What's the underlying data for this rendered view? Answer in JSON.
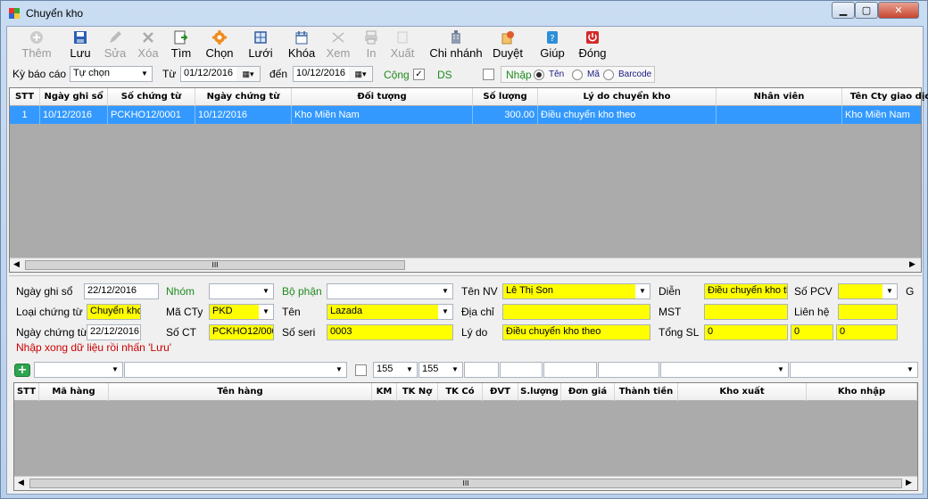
{
  "window": {
    "title": "Chuyển kho"
  },
  "toolbar": [
    {
      "label": "Thêm",
      "icon": "add-icon",
      "enabled": false
    },
    {
      "label": "Lưu",
      "icon": "save-icon",
      "enabled": true
    },
    {
      "label": "Sửa",
      "icon": "edit-icon",
      "enabled": false
    },
    {
      "label": "Xóa",
      "icon": "delete-icon",
      "enabled": false
    },
    {
      "label": "Tìm",
      "icon": "find-icon",
      "enabled": true
    },
    {
      "label": "Chọn",
      "icon": "gear-icon",
      "enabled": true
    },
    {
      "label": "Lưới",
      "icon": "grid-icon",
      "enabled": true
    },
    {
      "label": "Khóa",
      "icon": "lock-icon",
      "enabled": true
    },
    {
      "label": "Xem",
      "icon": "view-icon",
      "enabled": false
    },
    {
      "label": "In",
      "icon": "print-icon",
      "enabled": false
    },
    {
      "label": "Xuất",
      "icon": "export-icon",
      "enabled": false
    },
    {
      "label": "Chi nhánh",
      "icon": "branch-icon",
      "enabled": true
    },
    {
      "label": "Duyệt",
      "icon": "approve-icon",
      "enabled": true
    },
    {
      "label": "Giúp",
      "icon": "help-icon",
      "enabled": true
    },
    {
      "label": "Đóng",
      "icon": "power-icon",
      "enabled": true
    }
  ],
  "filter": {
    "period_label": "Kỳ báo cáo",
    "period_value": "Tự chọn",
    "from_label": "Từ",
    "from_value": "01/12/2016",
    "to_label": "đến",
    "to_value": "10/12/2016",
    "cong_label": "Cộng",
    "ds_label": "DS",
    "nhap_label": "Nhập",
    "radio_ten": "Tên",
    "radio_ma": "Mã",
    "radio_barcode": "Barcode"
  },
  "top_grid": {
    "headers": [
      "STT",
      "Ngày ghi sổ",
      "Số chứng từ",
      "Ngày chứng từ",
      "Đối tượng",
      "Số lượng",
      "Lý do chuyển kho",
      "Nhân viên",
      "Tên Cty giao dịch"
    ],
    "rows": [
      [
        "1",
        "10/12/2016",
        "PCKHO12/0001",
        "10/12/2016",
        "Kho Miền Nam",
        "300.00",
        "Điều chuyển kho theo",
        "",
        "Kho Miền Nam"
      ]
    ],
    "scroll_glyph": "III"
  },
  "form": {
    "ngay_ghi_so_label": "Ngày ghi sổ",
    "ngay_ghi_so": "22/12/2016",
    "nhom_label": "Nhóm",
    "bo_phan_label": "Bộ phận",
    "ten_nv_label": "Tên NV",
    "ten_nv": "Lê Thị Son",
    "dien_label": "Diễn",
    "dien": "Điều chuyển kho th",
    "so_pcv_label": "Số PCV",
    "extra_label": "G",
    "loai_ct_label": "Loại chứng từ",
    "loai_ct": "Chuyển kho",
    "ma_cty_label": "Mã CTy",
    "ma_cty": "PKD",
    "ten_label": "Tên",
    "ten": "Lazada",
    "dia_chi_label": "Địa chỉ",
    "mst_label": "MST",
    "lien_he_label": "Liên hệ",
    "ngay_ct_label": "Ngày chứng từ",
    "ngay_ct": "22/12/2016",
    "so_ct_label": "Số CT",
    "so_ct": "PCKHO12/000",
    "so_seri_label": "Số seri",
    "so_seri": "0003",
    "ly_do_label": "Lý do",
    "ly_do": "Điều chuyển kho theo",
    "tong_sl_label": "Tổng SL",
    "tong_sl_1": "0",
    "tong_sl_2": "0",
    "tong_sl_3": "0",
    "hint": "Nhập xong dữ liệu rồi nhấn 'Lưu'"
  },
  "detail_bar": {
    "tk1": "155",
    "tk2": "155"
  },
  "bottom_grid": {
    "headers": [
      "STT",
      "Mã hàng",
      "Tên hàng",
      "KM",
      "TK Nợ",
      "TK Có",
      "ĐVT",
      "S.lượng",
      "Đơn giá",
      "Thành tiền",
      "Kho xuất",
      "Kho nhập"
    ],
    "scroll_glyph": "III"
  },
  "colors": {
    "selection": "#3399ff",
    "required_field": "#ffff00",
    "hint": "#cc0000",
    "green_label": "#1f8a1f"
  }
}
